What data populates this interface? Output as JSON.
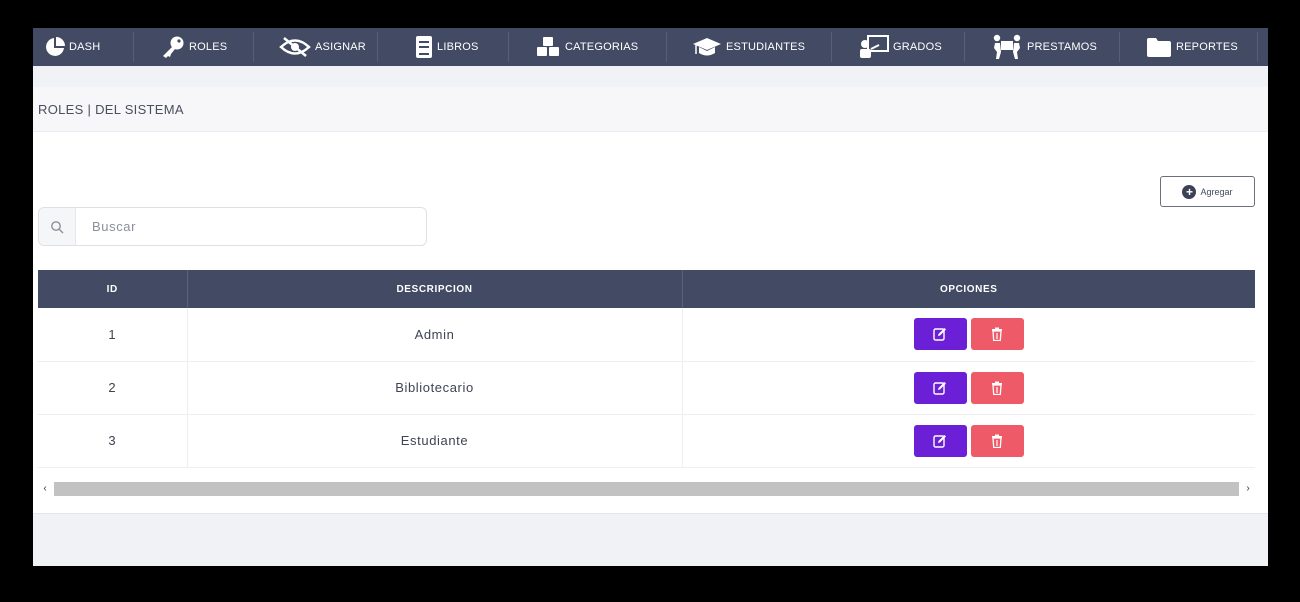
{
  "nav": {
    "items": [
      {
        "label": "DASH",
        "icon": "pie-chart-icon"
      },
      {
        "label": "ROLES",
        "icon": "key-icon"
      },
      {
        "label": "ASIGNAR",
        "icon": "eye-slash-icon"
      },
      {
        "label": "LIBROS",
        "icon": "book-icon"
      },
      {
        "label": "CATEGORIAS",
        "icon": "cubes-icon"
      },
      {
        "label": "ESTUDIANTES",
        "icon": "graduation-cap-icon"
      },
      {
        "label": "GRADOS",
        "icon": "chalkboard-teacher-icon"
      },
      {
        "label": "PRESTAMOS",
        "icon": "people-carry-icon"
      },
      {
        "label": "REPORTES",
        "icon": "folder-icon"
      }
    ]
  },
  "page": {
    "title": "ROLES | DEL SISTEMA",
    "add_label": "Agregar"
  },
  "search": {
    "placeholder": "Buscar",
    "value": ""
  },
  "table": {
    "headers": [
      "ID",
      "DESCRIPCION",
      "OPCIONES"
    ],
    "rows": [
      {
        "id": "1",
        "descripcion": "Admin"
      },
      {
        "id": "2",
        "descripcion": "Bibliotecario"
      },
      {
        "id": "3",
        "descripcion": "Estudiante"
      }
    ]
  },
  "scrollbar": {
    "left": "‹",
    "right": "›"
  },
  "colors": {
    "navbar": "#434a63",
    "edit": "#6b1fd6",
    "delete": "#ee5a67"
  }
}
